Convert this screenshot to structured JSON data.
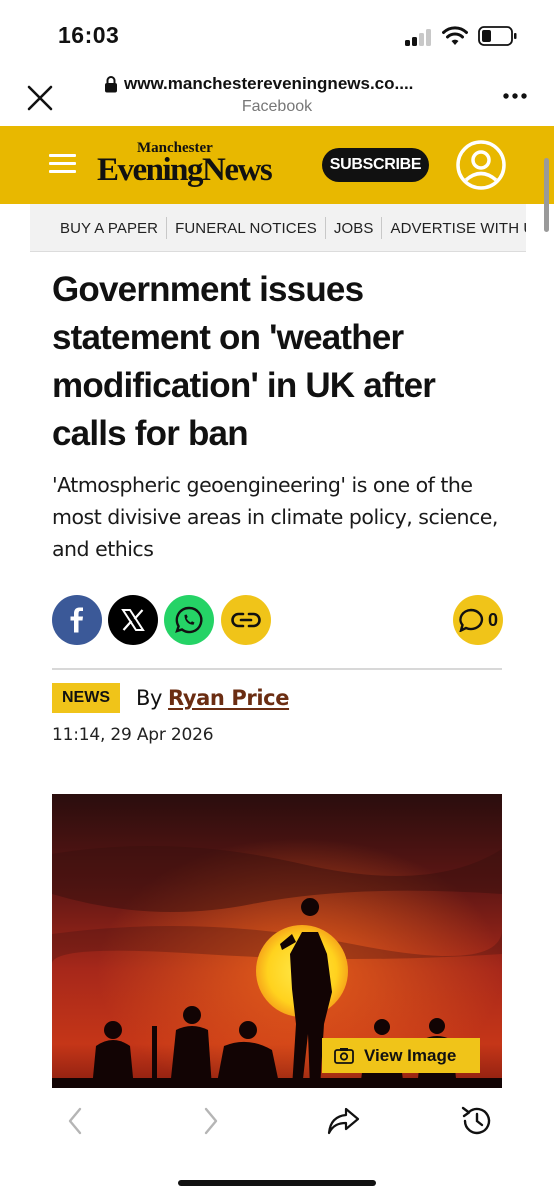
{
  "status_bar": {
    "time": "16:03",
    "icons": [
      "cellular-signal-icon",
      "wifi-icon",
      "battery-icon"
    ]
  },
  "browser": {
    "url": "www.manchestereveningnews.co....",
    "source": "Facebook",
    "close_icon": "close-icon",
    "more_icon": "more-icon"
  },
  "site_header": {
    "logo_top": "Manchester",
    "logo_main": "EveningNews",
    "subscribe_label": "SUBSCRIBE",
    "brand_color": "#e8b800"
  },
  "nav": {
    "items": [
      {
        "label": "BUY A PAPER"
      },
      {
        "label": "FUNERAL NOTICES"
      },
      {
        "label": "JOBS"
      },
      {
        "label": "ADVERTISE WITH US"
      }
    ]
  },
  "article": {
    "headline": "Government issues statement on 'weather modification' in UK after calls for ban",
    "standfirst": "'Atmospheric geoengineering' is one of the most divisive areas in climate policy, science, and ethics",
    "comment_count": "0",
    "category": "NEWS",
    "by_label": "By",
    "author": "Ryan Price",
    "timestamp": "11:14, 29 Apr 2026",
    "view_image_label": "View Image"
  },
  "share": {
    "icons": [
      "facebook-icon",
      "x-icon",
      "whatsapp-icon",
      "link-icon",
      "comment-icon"
    ]
  },
  "toolbar": {
    "icons": [
      "back-icon",
      "forward-icon",
      "share-icon",
      "history-icon"
    ]
  }
}
